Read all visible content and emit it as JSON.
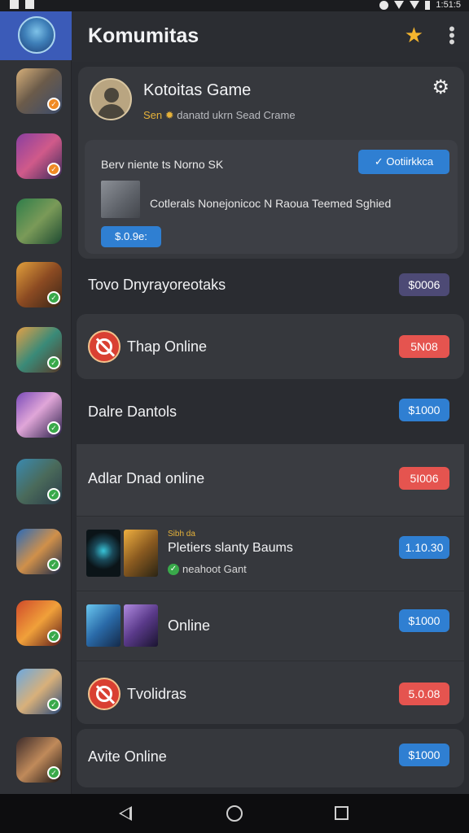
{
  "status_bar": {
    "left_icons": [
      "notification-icon",
      "notification-icon"
    ],
    "time": "1:51:5"
  },
  "header": {
    "title": "Komumitas",
    "star_icon": "star-icon",
    "more_icon": "more-vert-icon"
  },
  "profile": {
    "name": "Kotoitas Game",
    "subtitle_prefix": "Sen",
    "subtitle_text": "danatd ukrn Sead Crame",
    "settings_icon": "gear-icon"
  },
  "featured": {
    "title": "Berv niente ts Norno SK",
    "notify_label": "Ootiirkkca",
    "description": "Cotlerals Nonejonicoc N Raoua Teemed Sghied",
    "price": "$.0.9e:"
  },
  "list": [
    {
      "title": "Tovo Dnyrayoreotaks",
      "price": "$0006",
      "price_color": "purple"
    },
    {
      "title": "Thap Online",
      "price": "5N08",
      "price_color": "red"
    },
    {
      "title": "Dalre Dantols",
      "price": "$1000",
      "price_color": "blue"
    },
    {
      "title": "Adlar Dnad online",
      "price": "5I006",
      "price_color": "red"
    },
    {
      "label": "Sibh da",
      "title": "Pletiers slanty Baums",
      "status": "neahoot Gant",
      "price": "1.10.30",
      "price_color": "blue"
    },
    {
      "title": "Online",
      "price": "$1000",
      "price_color": "blue"
    },
    {
      "title": "Tvolidras",
      "price": "5.0.08",
      "price_color": "red"
    },
    {
      "title": "Avite Online",
      "price": "$1000",
      "price_color": "blue"
    }
  ],
  "colors": {
    "accent_blue": "#2f7fd2",
    "accent_red": "#e5544f",
    "accent_purple": "#4d4a75",
    "sidebar_active": "#3b5bb8",
    "star": "#f4b52e"
  }
}
